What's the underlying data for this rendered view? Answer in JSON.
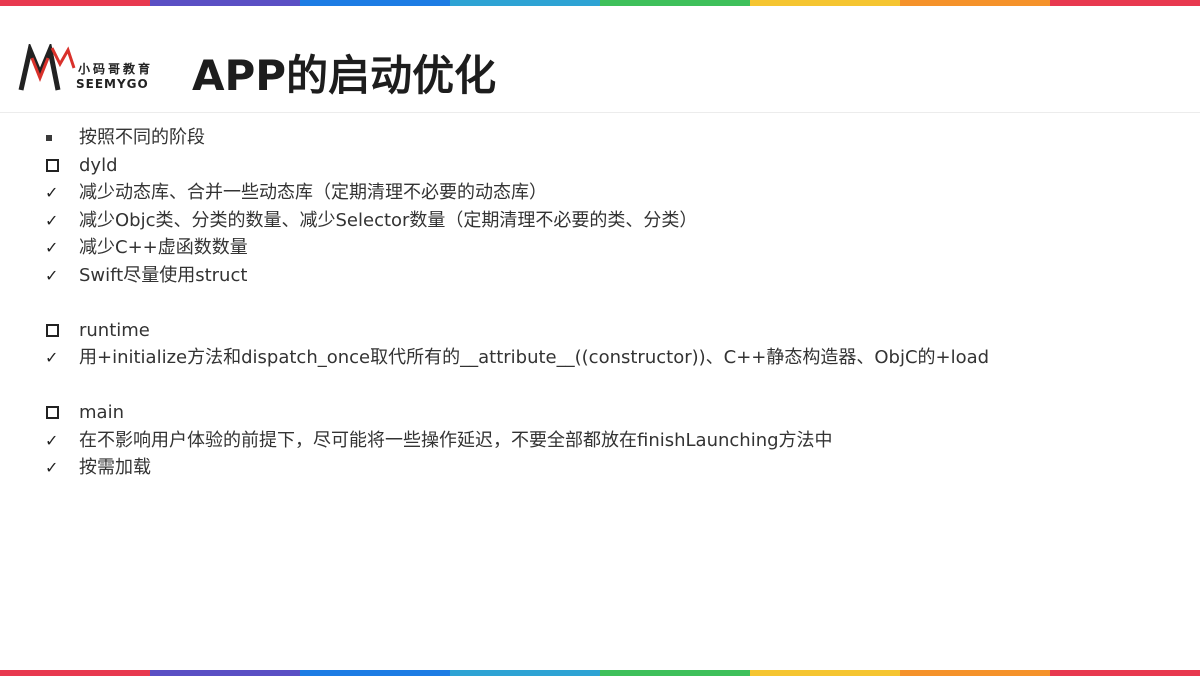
{
  "colors": {
    "stripes": [
      "#e8394f",
      "#5a4fc4",
      "#1d7ce4",
      "#2ea3d4",
      "#3ec05a",
      "#f5c531",
      "#f5922a",
      "#e8394f"
    ],
    "logo_red": "#d9312b"
  },
  "logo": {
    "cn": "小码哥教育",
    "en": "SEEMYGO"
  },
  "title": "APP的启动优化",
  "items": [
    {
      "marker": "square-bullet",
      "text": "按照不同的阶段"
    },
    {
      "marker": "hollow-box",
      "text": "dyld"
    },
    {
      "marker": "check",
      "text": "减少动态库、合并一些动态库（定期清理不必要的动态库）"
    },
    {
      "marker": "check",
      "text": "减少Objc类、分类的数量、减少Selector数量（定期清理不必要的类、分类）"
    },
    {
      "marker": "check",
      "text": "减少C++虚函数数量"
    },
    {
      "marker": "check",
      "text": "Swift尽量使用struct"
    },
    {
      "marker": "hollow-box",
      "text": "runtime"
    },
    {
      "marker": "check",
      "text": "用+initialize方法和dispatch_once取代所有的__attribute__((constructor))、C++静态构造器、ObjC的+load"
    },
    {
      "marker": "hollow-box",
      "text": "main"
    },
    {
      "marker": "check",
      "text": "在不影响用户体验的前提下，尽可能将一些操作延迟，不要全部都放在finishLaunching方法中"
    },
    {
      "marker": "check",
      "text": "按需加载"
    }
  ],
  "check_glyph": "✓"
}
